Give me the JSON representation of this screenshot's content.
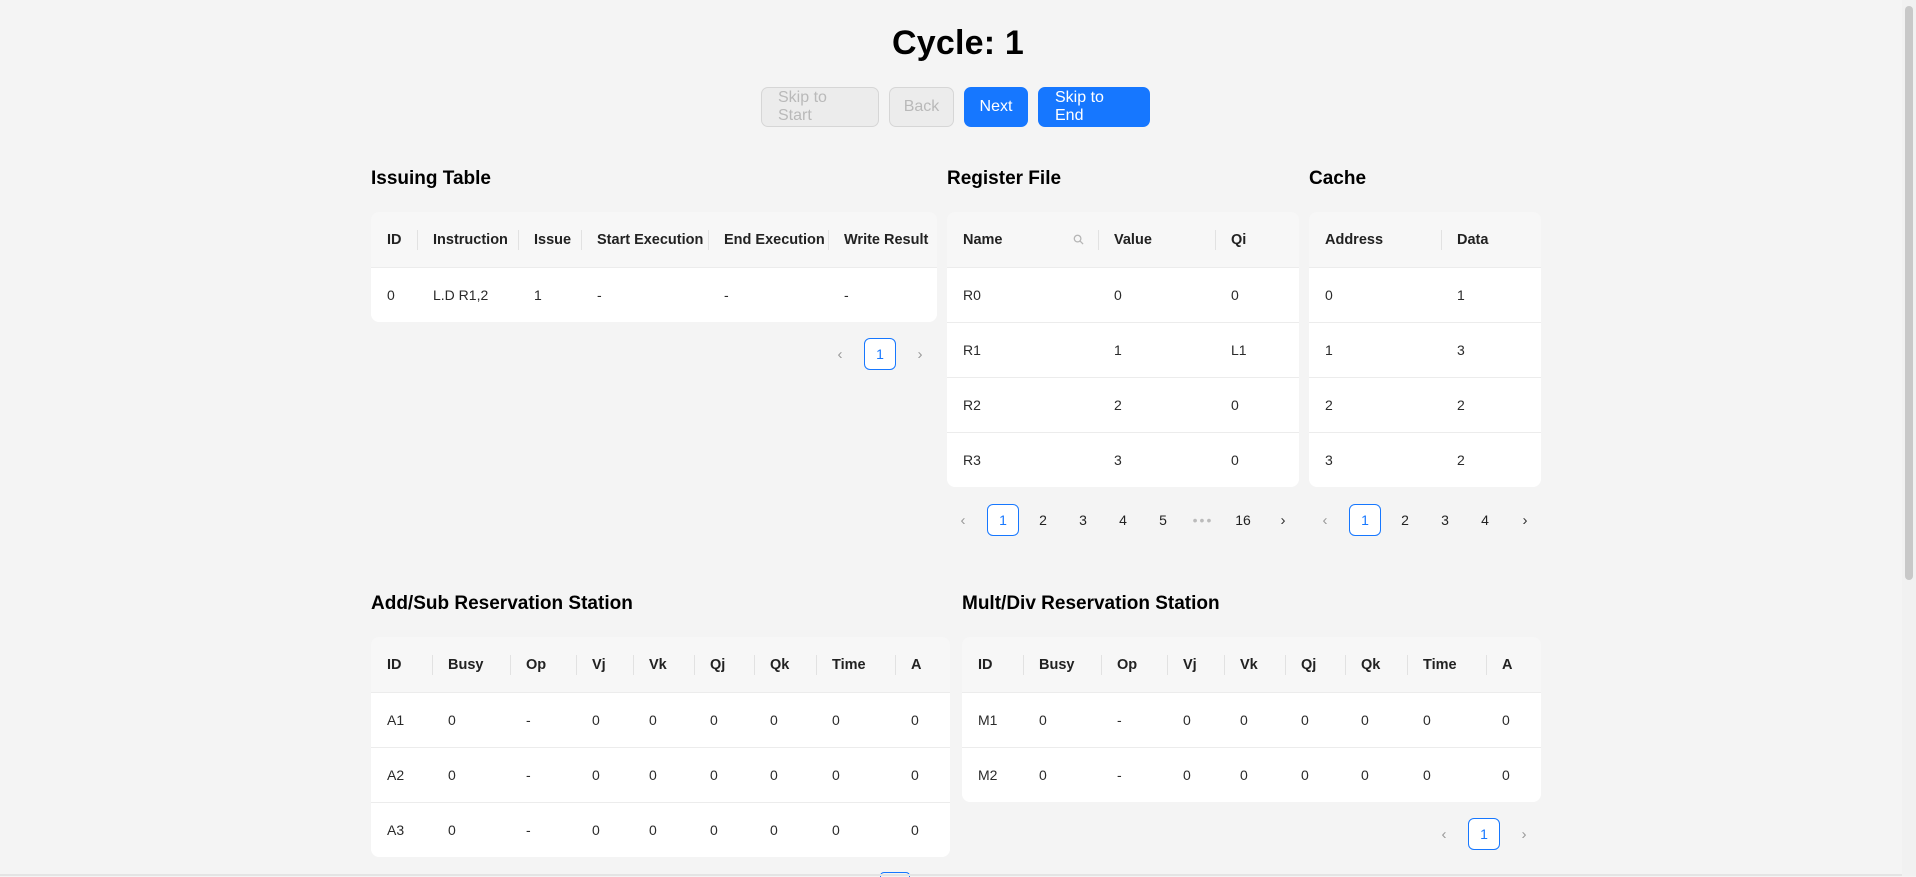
{
  "title": "Cycle: 1",
  "buttons": {
    "skip_start": "Skip to Start",
    "back": "Back",
    "next": "Next",
    "skip_end": "Skip to End"
  },
  "issuing": {
    "title": "Issuing Table",
    "headers": [
      "ID",
      "Instruction",
      "Issue",
      "Start Execution",
      "End Execution",
      "Write Result"
    ],
    "rows": [
      [
        "0",
        "L.D R1,2",
        "1",
        "-",
        "-",
        "-"
      ]
    ],
    "pagination": {
      "pages": [
        "1"
      ],
      "current": "1"
    }
  },
  "register": {
    "title": "Register File",
    "headers": [
      "Name",
      "Value",
      "Qi"
    ],
    "rows": [
      [
        "R0",
        "0",
        "0"
      ],
      [
        "R1",
        "1",
        "L1"
      ],
      [
        "R2",
        "2",
        "0"
      ],
      [
        "R3",
        "3",
        "0"
      ]
    ],
    "pagination": {
      "pages": [
        "1",
        "2",
        "3",
        "4",
        "5",
        "•••",
        "16"
      ],
      "current": "1"
    }
  },
  "cache": {
    "title": "Cache",
    "headers": [
      "Address",
      "Data"
    ],
    "rows": [
      [
        "0",
        "1"
      ],
      [
        "1",
        "3"
      ],
      [
        "2",
        "2"
      ],
      [
        "3",
        "2"
      ]
    ],
    "pagination": {
      "pages": [
        "1",
        "2",
        "3",
        "4"
      ],
      "current": "1"
    }
  },
  "addsub": {
    "title": "Add/Sub Reservation Station",
    "headers": [
      "ID",
      "Busy",
      "Op",
      "Vj",
      "Vk",
      "Qj",
      "Qk",
      "Time",
      "A"
    ],
    "rows": [
      [
        "A1",
        "0",
        "-",
        "0",
        "0",
        "0",
        "0",
        "0",
        "0"
      ],
      [
        "A2",
        "0",
        "-",
        "0",
        "0",
        "0",
        "0",
        "0",
        "0"
      ],
      [
        "A3",
        "0",
        "-",
        "0",
        "0",
        "0",
        "0",
        "0",
        "0"
      ]
    ]
  },
  "multdiv": {
    "title": "Mult/Div Reservation Station",
    "headers": [
      "ID",
      "Busy",
      "Op",
      "Vj",
      "Vk",
      "Qj",
      "Qk",
      "Time",
      "A"
    ],
    "rows": [
      [
        "M1",
        "0",
        "-",
        "0",
        "0",
        "0",
        "0",
        "0",
        "0"
      ],
      [
        "M2",
        "0",
        "-",
        "0",
        "0",
        "0",
        "0",
        "0",
        "0"
      ]
    ],
    "pagination": {
      "pages": [
        "1"
      ],
      "current": "1"
    }
  },
  "icons": {
    "prev": "chevron-left-icon",
    "next": "chevron-right-icon",
    "search": "search-icon"
  },
  "colors": {
    "primary": "#1677ff",
    "background": "#f4f4f4"
  }
}
